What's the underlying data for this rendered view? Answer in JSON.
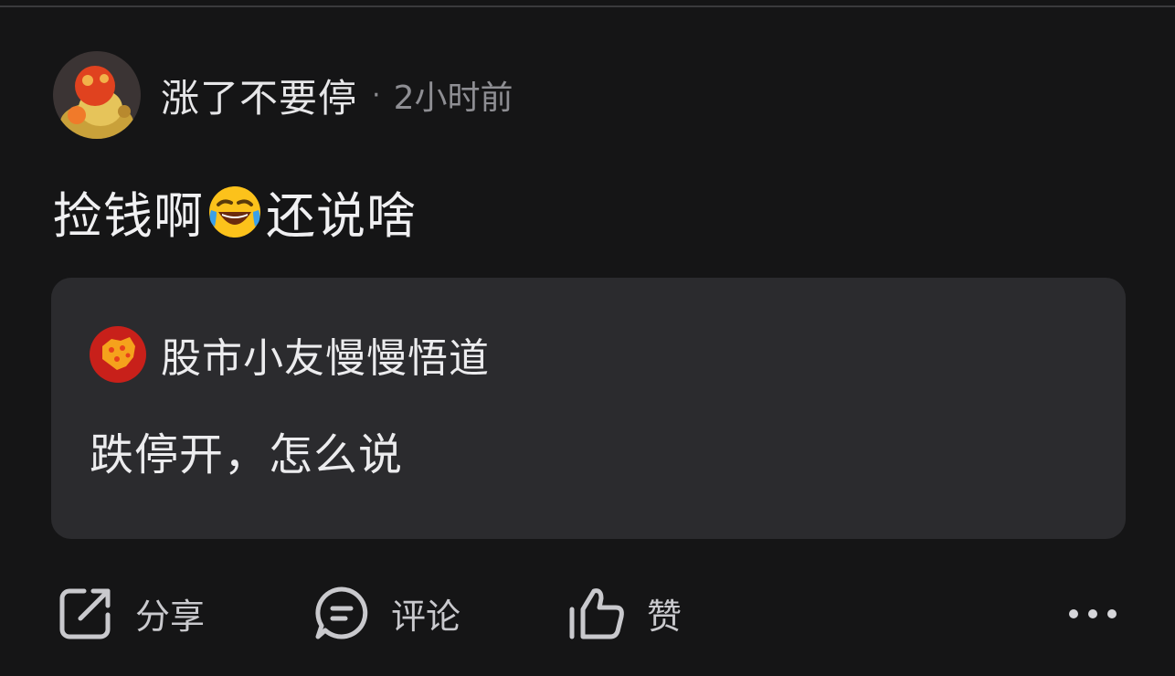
{
  "post": {
    "author": "涨了不要停",
    "separator": "·",
    "time": "2小时前",
    "content_before": "捡钱啊",
    "emoji": "rolling-laughing-emoji",
    "content_after": "还说啥"
  },
  "quote": {
    "author": "股市小友慢慢悟道",
    "text": "跌停开，怎么说"
  },
  "actions": {
    "share_label": "分享",
    "comment_label": "评论",
    "like_label": "赞"
  },
  "icons": {
    "share": "share-icon",
    "comment": "comment-icon",
    "like": "thumbs-up-icon",
    "more": "more-icon"
  },
  "colors": {
    "background": "#151516",
    "quote_background": "#2b2b2e",
    "primary_text": "#e8e8ea",
    "secondary_text": "#8e8e93"
  }
}
